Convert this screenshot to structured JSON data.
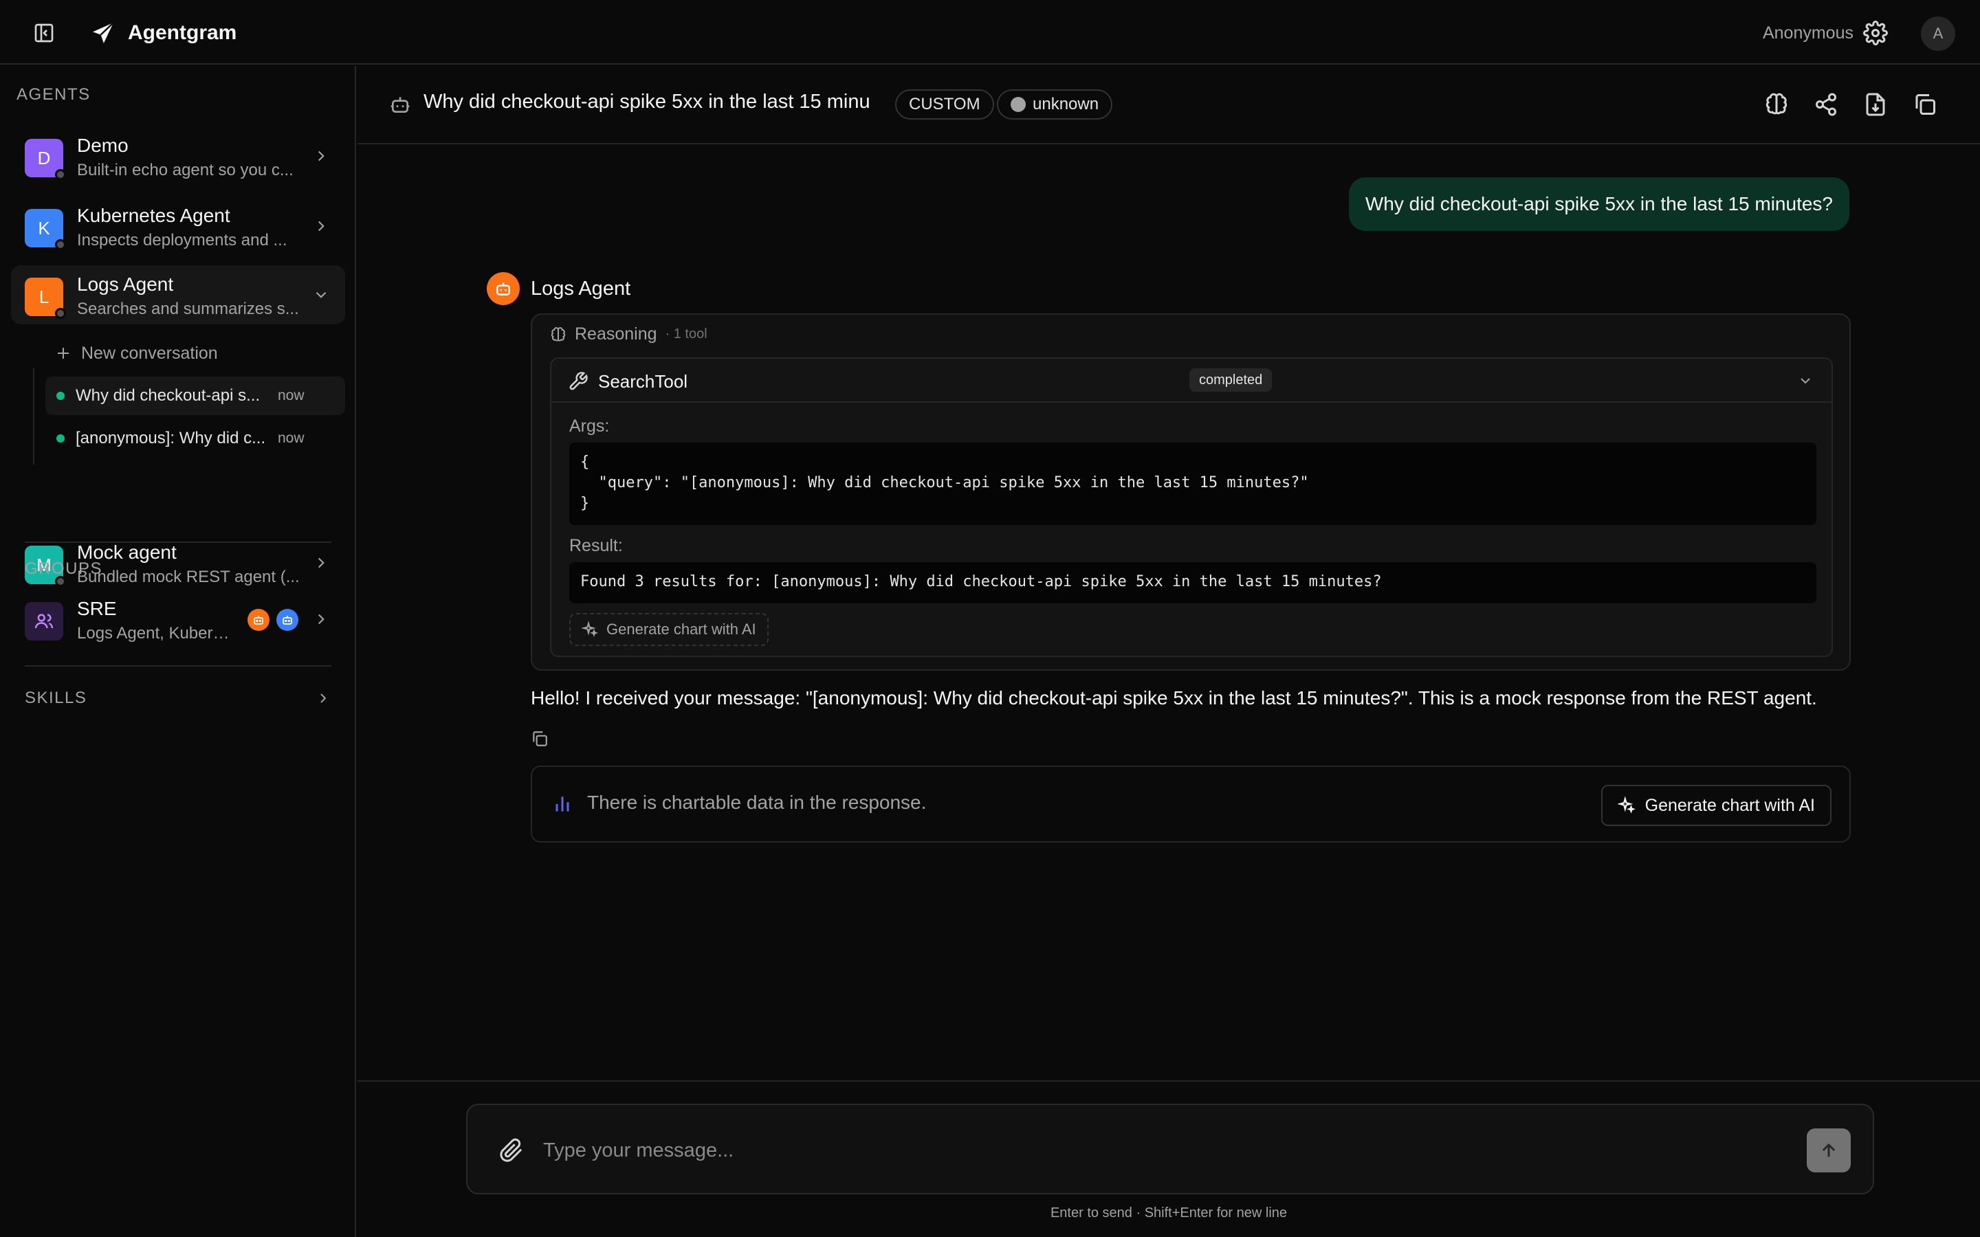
{
  "app": {
    "brand": "Agentgram",
    "user": "Anonymous",
    "avatar_initial": "A"
  },
  "sidebar": {
    "agents_label": "AGENTS",
    "agents": [
      {
        "initial": "D",
        "name": "Demo",
        "desc": "Built-in echo agent so you c...",
        "color": "#8b5cf6"
      },
      {
        "initial": "K",
        "name": "Kubernetes Agent",
        "desc": "Inspects deployments and ...",
        "color": "#3b82f6"
      },
      {
        "initial": "L",
        "name": "Logs Agent",
        "desc": "Searches and summarizes s...",
        "color": "#f97316"
      },
      {
        "initial": "M",
        "name": "Mock agent",
        "desc": "Bundled mock REST agent (...",
        "color": "#14b8a6"
      }
    ],
    "new_conversation": "New conversation",
    "conversations": [
      {
        "title": "Why did checkout-api s...",
        "time": "now"
      },
      {
        "title": "[anonymous]: Why did c...",
        "time": "now"
      }
    ],
    "groups_label": "GROUPS",
    "group": {
      "name": "SRE",
      "desc": "Logs Agent, Kubern..."
    },
    "skills_label": "SKILLS"
  },
  "header": {
    "title": "Why did checkout-api spike 5xx in the last 15 minu",
    "type_badge": "CUSTOM",
    "status_badge": "unknown"
  },
  "chat": {
    "user_message": "Why did checkout-api spike 5xx in the last 15 minutes?",
    "agent_name": "Logs Agent",
    "reasoning_label": "Reasoning",
    "reasoning_count": "· 1 tool",
    "tool": {
      "name": "SearchTool",
      "status": "completed",
      "args_label": "Args:",
      "args_code": "{\n  \"query\": \"[anonymous]: Why did checkout-api spike 5xx in the last 15 minutes?\"\n}",
      "result_label": "Result:",
      "result_code": "Found 3 results for: [anonymous]: Why did checkout-api spike 5xx in the last 15 minutes?",
      "gen_chart": "Generate chart with AI"
    },
    "reply": "Hello! I received your message: \"[anonymous]: Why did checkout-api spike 5xx in the last 15 minutes?\". This is a mock response from the REST agent.",
    "chartable_text": "There is chartable data in the response.",
    "chartable_button": "Generate chart with AI"
  },
  "composer": {
    "placeholder": "Type your message...",
    "hint": "Enter to send · Shift+Enter for new line"
  }
}
